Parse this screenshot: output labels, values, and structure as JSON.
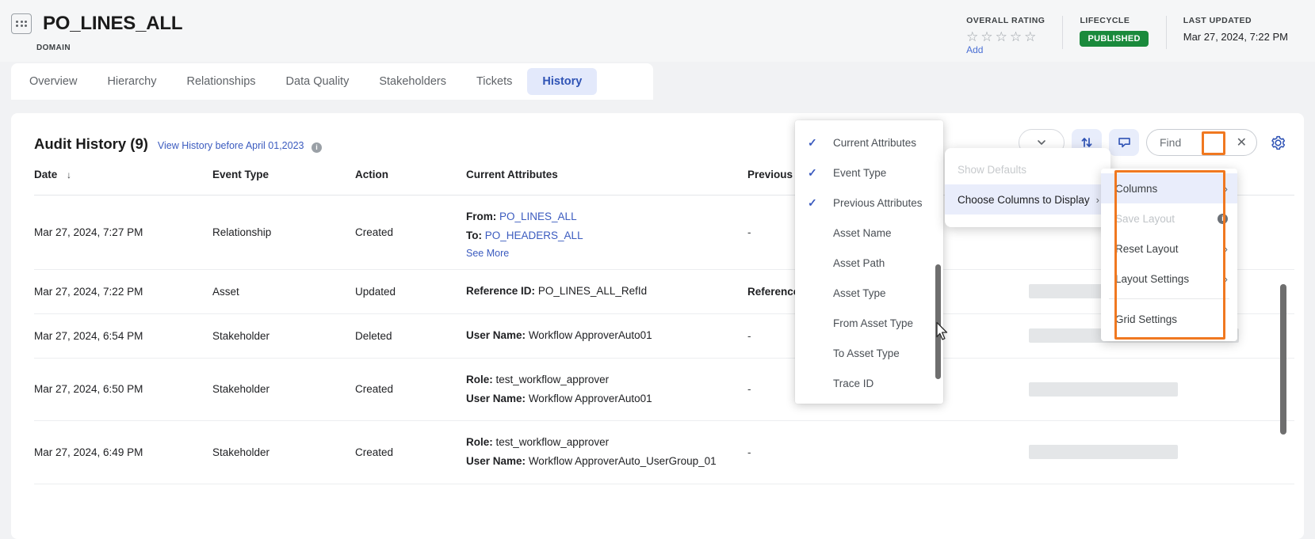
{
  "header": {
    "asset_title": "PO_LINES_ALL",
    "asset_subtype": "DOMAIN",
    "domain_icon": "grid-dots-icon",
    "meta": {
      "rating_label": "OVERALL RATING",
      "rating_stars": 5,
      "rating_filled": 0,
      "rating_add_link": "Add",
      "lifecycle_label": "LIFECYCLE",
      "lifecycle_value": "PUBLISHED",
      "lifecycle_color": "#1a8a3c",
      "last_updated_label": "LAST UPDATED",
      "last_updated_value": "Mar 27, 2024, 7:22 PM"
    }
  },
  "tabs": [
    {
      "label": "Overview",
      "active": false
    },
    {
      "label": "Hierarchy",
      "active": false
    },
    {
      "label": "Relationships",
      "active": false
    },
    {
      "label": "Data Quality",
      "active": false
    },
    {
      "label": "Stakeholders",
      "active": false
    },
    {
      "label": "Tickets",
      "active": false
    },
    {
      "label": "History",
      "active": true
    }
  ],
  "card": {
    "title": "Audit History (9)",
    "view_history_link": "View History before April 01,2023",
    "info_icon": "info-icon"
  },
  "toolbar": {
    "filter_chevron_icon": "chevron-down-icon",
    "sort_icon": "sort-updown-icon",
    "comment_icon": "comment-icon",
    "find_placeholder": "Find",
    "find_value": "",
    "find_clear_icon": "close-icon",
    "gear_icon": "gear-icon"
  },
  "table": {
    "columns": [
      {
        "key": "date",
        "label": "Date",
        "sorted": true,
        "sort_icon": "arrow-down-icon"
      },
      {
        "key": "event",
        "label": "Event Type"
      },
      {
        "key": "action",
        "label": "Action"
      },
      {
        "key": "attrs",
        "label": "Current Attributes"
      },
      {
        "key": "prev",
        "label": "Previous"
      }
    ],
    "rows": [
      {
        "date": "Mar 27, 2024, 7:27 PM",
        "event": "Relationship",
        "action": "Created",
        "attrs": [
          {
            "label": "From:",
            "value": "PO_LINES_ALL",
            "link": true
          },
          {
            "label": "To:",
            "value": "PO_HEADERS_ALL",
            "link": true
          }
        ],
        "see_more": "See More",
        "prev": "-"
      },
      {
        "date": "Mar 27, 2024, 7:22 PM",
        "event": "Asset",
        "action": "Updated",
        "attrs": [
          {
            "label": "Reference ID:",
            "value": "PO_LINES_ALL_RefId",
            "link": false
          }
        ],
        "see_more": "",
        "prev": "Reference"
      },
      {
        "date": "Mar 27, 2024, 6:54 PM",
        "event": "Stakeholder",
        "action": "Deleted",
        "attrs": [
          {
            "label": "User Name:",
            "value": "Workflow ApproverAuto01",
            "link": false
          }
        ],
        "see_more": "",
        "prev": "-"
      },
      {
        "date": "Mar 27, 2024, 6:50 PM",
        "event": "Stakeholder",
        "action": "Created",
        "attrs": [
          {
            "label": "Role:",
            "value": "test_workflow_approver",
            "link": false
          },
          {
            "label": "User Name:",
            "value": "Workflow ApproverAuto01",
            "link": false
          }
        ],
        "see_more": "",
        "prev": "-"
      },
      {
        "date": "Mar 27, 2024, 6:49 PM",
        "event": "Stakeholder",
        "action": "Created",
        "attrs": [
          {
            "label": "Role:",
            "value": "test_workflow_approver",
            "link": false
          },
          {
            "label": "User Name:",
            "value": "Workflow ApproverAuto_UserGroup_01",
            "link": false
          }
        ],
        "see_more": "",
        "prev": "-"
      }
    ]
  },
  "menus": {
    "columns_list": {
      "items": [
        {
          "label": "Current Attributes",
          "checked": true
        },
        {
          "label": "Event Type",
          "checked": true
        },
        {
          "label": "Previous Attributes",
          "checked": true
        },
        {
          "label": "Asset Name",
          "checked": false
        },
        {
          "label": "Asset Path",
          "checked": false
        },
        {
          "label": "Asset Type",
          "checked": false
        },
        {
          "label": "From Asset Type",
          "checked": false
        },
        {
          "label": "To Asset Type",
          "checked": false
        },
        {
          "label": "Trace ID",
          "checked": false
        }
      ],
      "check_icon": "checkmark-icon"
    },
    "choose_columns": {
      "items": [
        {
          "label": "Show Defaults",
          "disabled": true,
          "submenu": false,
          "hover": false
        },
        {
          "label": "Choose Columns to Display",
          "disabled": false,
          "submenu": true,
          "hover": true
        }
      ],
      "chevron_icon": "chevron-right-icon"
    },
    "gear_menu": {
      "items": [
        {
          "label": "Columns",
          "selected": true,
          "disabled": false,
          "submenu": true,
          "info": false
        },
        {
          "label": "Save Layout",
          "selected": false,
          "disabled": true,
          "submenu": false,
          "info": true
        },
        {
          "label": "Reset Layout",
          "selected": false,
          "disabled": false,
          "submenu": true,
          "info": false
        },
        {
          "label": "Layout Settings",
          "selected": false,
          "disabled": false,
          "submenu": true,
          "info": false
        },
        {
          "label": "Grid Settings",
          "selected": false,
          "disabled": false,
          "submenu": false,
          "info": false
        }
      ],
      "chevron_icon": "chevron-right-icon",
      "info_icon": "info-icon",
      "highlight_color": "#f07820"
    }
  }
}
